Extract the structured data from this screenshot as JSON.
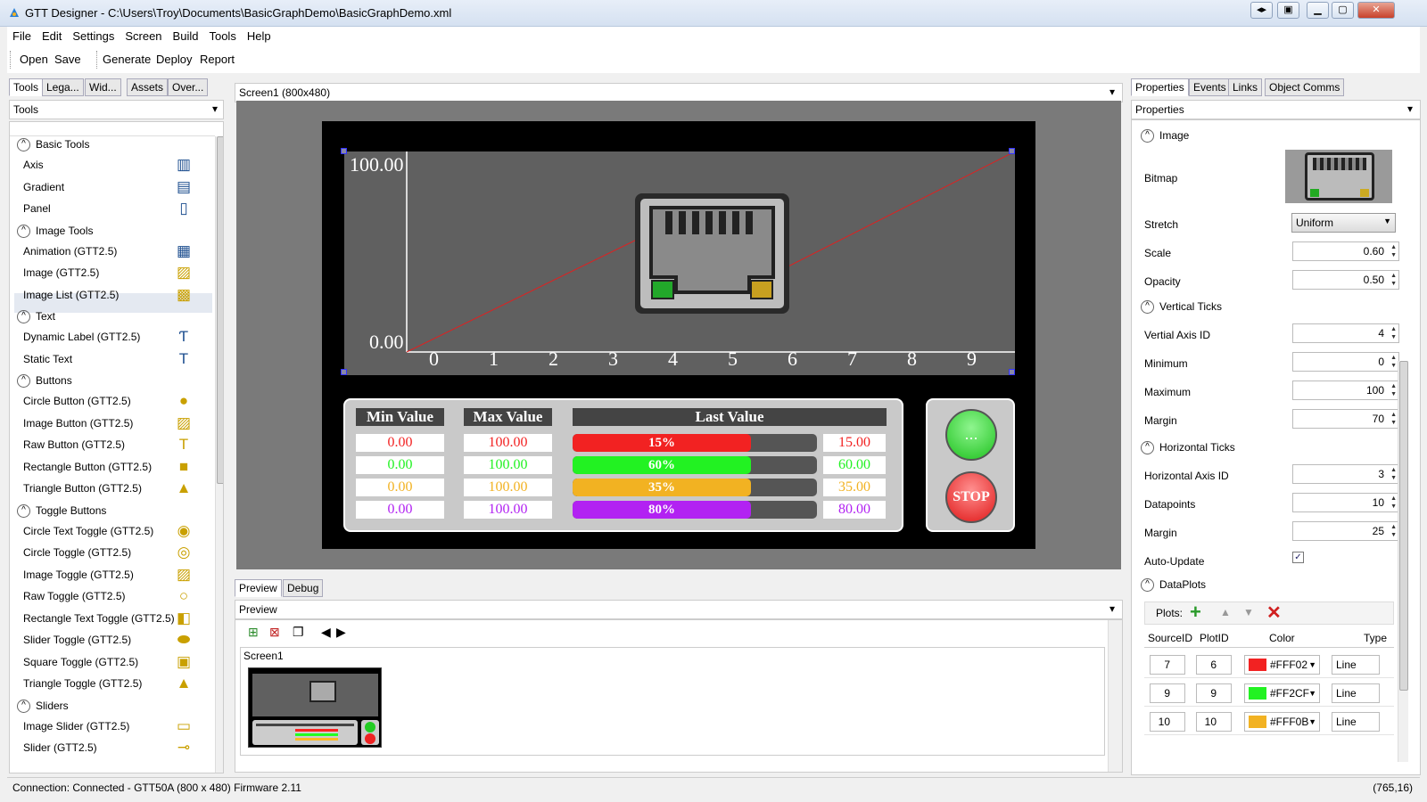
{
  "window": {
    "title": "GTT Designer - C:\\Users\\Troy\\Documents\\BasicGraphDemo\\BasicGraphDemo.xml"
  },
  "menu": [
    "File",
    "Edit",
    "Settings",
    "Screen",
    "Build",
    "Tools",
    "Help"
  ],
  "toolbar": {
    "open": "Open",
    "save": "Save",
    "generate": "Generate",
    "deploy": "Deploy",
    "report": "Report"
  },
  "left": {
    "tabs": [
      "Tools",
      "Lega...",
      "Wid...",
      "Assets",
      "Over..."
    ],
    "header": "Tools",
    "sections": [
      {
        "title": "Basic Tools",
        "items": [
          "Axis",
          "Gradient",
          "Panel"
        ]
      },
      {
        "title": "Image Tools",
        "items": [
          "Animation (GTT2.5)",
          "Image (GTT2.5)",
          "Image List (GTT2.5)"
        ]
      },
      {
        "title": "Text",
        "items": [
          "Dynamic Label (GTT2.5)",
          "Static Text"
        ]
      },
      {
        "title": "Buttons",
        "items": [
          "Circle Button (GTT2.5)",
          "Image Button (GTT2.5)",
          "Raw Button (GTT2.5)",
          "Rectangle Button (GTT2.5)",
          "Triangle Button (GTT2.5)"
        ]
      },
      {
        "title": "Toggle Buttons",
        "items": [
          "Circle Text Toggle (GTT2.5)",
          "Circle Toggle (GTT2.5)",
          "Image Toggle (GTT2.5)",
          "Raw Toggle (GTT2.5)",
          "Rectangle Text Toggle (GTT2.5)",
          "Slider Toggle (GTT2.5)",
          "Square Toggle (GTT2.5)",
          "Triangle Toggle (GTT2.5)"
        ]
      },
      {
        "title": "Sliders",
        "items": [
          "Image Slider (GTT2.5)",
          "Slider (GTT2.5)"
        ]
      }
    ]
  },
  "screen": {
    "header": "Screen1 (800x480)",
    "graph": {
      "ymax": "100.00",
      "ymin": "0.00",
      "xticks": [
        "0",
        "1",
        "2",
        "3",
        "4",
        "5",
        "6",
        "7",
        "8",
        "9"
      ]
    },
    "table": {
      "headers": {
        "min": "Min Value",
        "max": "Max Value",
        "last": "Last Value"
      },
      "rows": [
        {
          "min": "0.00",
          "max": "100.00",
          "pct": "15%",
          "fill": 0.73,
          "val": "15.00",
          "color": "#f22222"
        },
        {
          "min": "0.00",
          "max": "100.00",
          "pct": "60%",
          "fill": 0.73,
          "val": "60.00",
          "color": "#22f222"
        },
        {
          "min": "0.00",
          "max": "100.00",
          "pct": "35%",
          "fill": 0.73,
          "val": "35.00",
          "color": "#f2b222"
        },
        {
          "min": "0.00",
          "max": "100.00",
          "pct": "80%",
          "fill": 0.73,
          "val": "80.00",
          "color": "#b222f2"
        }
      ]
    },
    "go_label": "...",
    "stop_label": "STOP"
  },
  "bottom": {
    "tabs": [
      "Preview",
      "Debug"
    ],
    "header": "Preview",
    "thumb_label": "Screen1"
  },
  "right": {
    "tabs": [
      "Properties",
      "Events",
      "Links",
      "Object Comms"
    ],
    "header": "Properties",
    "image": {
      "title": "Image",
      "bitmap": "Bitmap",
      "stretch_label": "Stretch",
      "stretch": "Uniform",
      "scale_label": "Scale",
      "scale": "0.60",
      "opacity_label": "Opacity",
      "opacity": "0.50"
    },
    "vticks": {
      "title": "Vertical Ticks",
      "id_label": "Vertial Axis ID",
      "id": "4",
      "min_label": "Minimum",
      "min": "0",
      "max_label": "Maximum",
      "max": "100",
      "margin_label": "Margin",
      "margin": "70"
    },
    "hticks": {
      "title": "Horizontal Ticks",
      "id_label": "Horizontal Axis ID",
      "id": "3",
      "dp_label": "Datapoints",
      "dp": "10",
      "margin_label": "Margin",
      "margin": "25",
      "auto_label": "Auto-Update"
    },
    "dataplots": {
      "title": "DataPlots",
      "plots_label": "Plots:",
      "cols": [
        "SourceID",
        "PlotID",
        "Color",
        "Type"
      ],
      "rows": [
        {
          "src": "7",
          "plot": "6",
          "color": "#FFF02",
          "swatch": "#f22222",
          "type": "Line"
        },
        {
          "src": "9",
          "plot": "9",
          "color": "#FF2CF",
          "swatch": "#22f222",
          "type": "Line"
        },
        {
          "src": "10",
          "plot": "10",
          "color": "#FFF0B",
          "swatch": "#f2b222",
          "type": "Line"
        }
      ]
    }
  },
  "status": {
    "left": "Connection: Connected - GTT50A (800 x 480) Firmware 2.11",
    "right": "(765,16)"
  }
}
